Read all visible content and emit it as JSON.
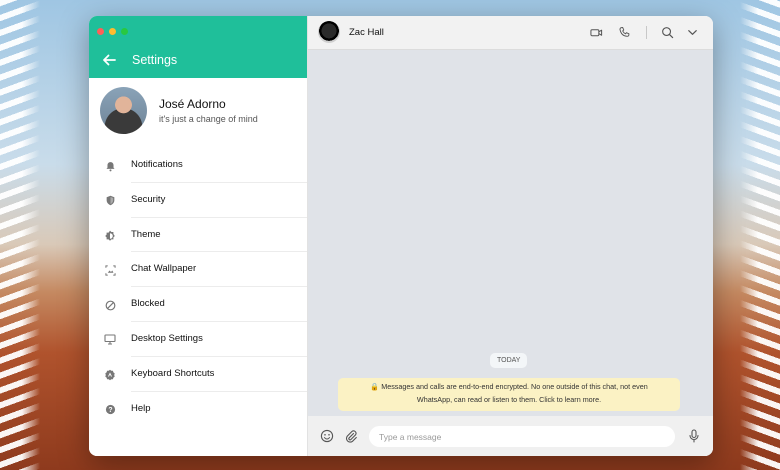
{
  "colors": {
    "accent": "#1fbf9a",
    "traffic_close": "#ff5f57",
    "traffic_min": "#febc2e",
    "traffic_max": "#28c840",
    "notice_bg": "#fbf2c4"
  },
  "settings": {
    "title": "Settings",
    "back_icon": "arrow-left-icon"
  },
  "profile": {
    "name": "José Adorno",
    "status": "it's just a change of mind"
  },
  "menu": [
    {
      "label": "Notifications",
      "icon": "bell-icon"
    },
    {
      "label": "Security",
      "icon": "shield-icon"
    },
    {
      "label": "Theme",
      "icon": "theme-icon"
    },
    {
      "label": "Chat Wallpaper",
      "icon": "wallpaper-icon"
    },
    {
      "label": "Blocked",
      "icon": "blocked-icon"
    },
    {
      "label": "Desktop Settings",
      "icon": "desktop-icon"
    },
    {
      "label": "Keyboard Shortcuts",
      "icon": "keyboard-icon"
    },
    {
      "label": "Help",
      "icon": "help-icon"
    }
  ],
  "chat": {
    "contact_name": "Zac Hall",
    "date_chip": "TODAY",
    "encryption_notice_line1": "🔒 Messages and calls are end-to-end encrypted. No one outside of this chat, not even",
    "encryption_notice_line2": "WhatsApp, can read or listen to them. Click to learn more.",
    "header_icons": [
      "video-call-icon",
      "phone-icon",
      "search-icon",
      "chevron-down-icon"
    ]
  },
  "composer": {
    "placeholder": "Type a message",
    "icons": [
      "emoji-icon",
      "attach-icon",
      "microphone-icon"
    ]
  }
}
